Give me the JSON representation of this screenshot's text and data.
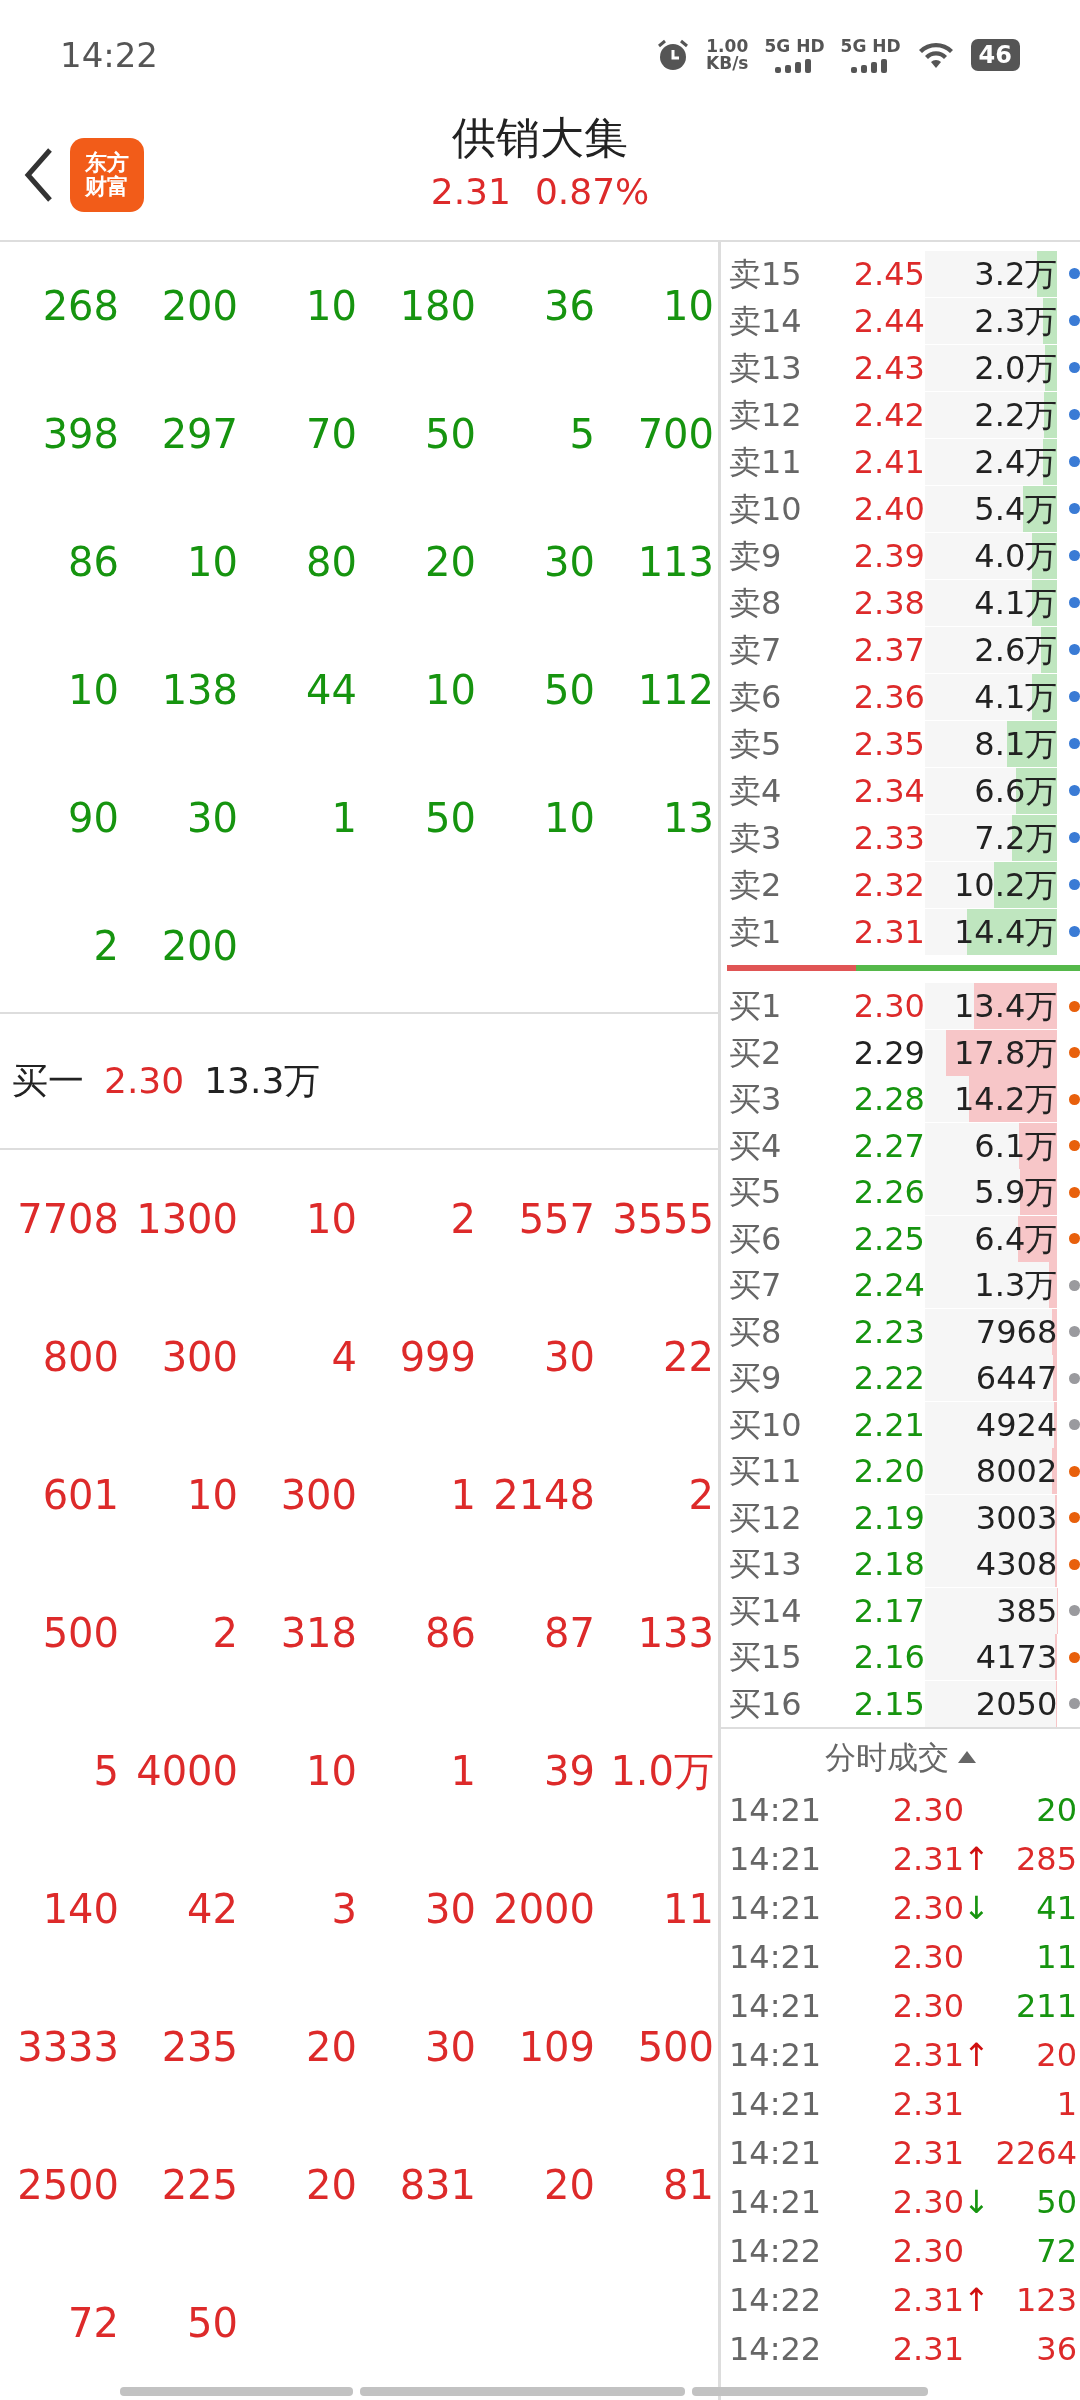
{
  "status_bar": {
    "time": "14:22",
    "net_speed": "1.00",
    "net_unit": "KB/s",
    "signals": [
      {
        "label": "5G HD"
      },
      {
        "label": "5G HD"
      }
    ],
    "battery": "46"
  },
  "header": {
    "logo_lines": [
      "东方",
      "财富"
    ],
    "title": "供销大集",
    "price": "2.31",
    "change": "0.87%"
  },
  "sell_queue": {
    "rows": [
      [
        "268",
        "200",
        "10",
        "180",
        "36",
        "10"
      ],
      [
        "398",
        "297",
        "70",
        "50",
        "5",
        "700"
      ],
      [
        "86",
        "10",
        "80",
        "20",
        "30",
        "113"
      ],
      [
        "10",
        "138",
        "44",
        "10",
        "50",
        "112"
      ],
      [
        "90",
        "30",
        "1",
        "50",
        "10",
        "13"
      ],
      [
        "2",
        "200"
      ]
    ]
  },
  "buy_one": {
    "label": "买一",
    "price": "2.30",
    "volume": "13.3万"
  },
  "buy_queue": {
    "rows": [
      [
        "7708",
        "1300",
        "10",
        "2",
        "557",
        "3555"
      ],
      [
        "800",
        "300",
        "4",
        "999",
        "30",
        "22"
      ],
      [
        "601",
        "10",
        "300",
        "1",
        "2148",
        "2"
      ],
      [
        "500",
        "2",
        "318",
        "86",
        "87",
        "133"
      ],
      [
        "5",
        "4000",
        "10",
        "1",
        "39",
        "1.0万"
      ],
      [
        "140",
        "42",
        "3",
        "30",
        "2000",
        "11"
      ],
      [
        "3333",
        "235",
        "20",
        "30",
        "109",
        "500"
      ],
      [
        "2500",
        "225",
        "20",
        "831",
        "20",
        "81"
      ],
      [
        "72",
        "50"
      ]
    ]
  },
  "order_book": {
    "asks": [
      {
        "label": "卖15",
        "price": {
          "text": "2.45",
          "color": "#dd2a2a"
        },
        "volume": "3.2万",
        "level": 0.15,
        "color": "#3a7bd5"
      },
      {
        "label": "卖14",
        "price": {
          "text": "2.44",
          "color": "#dd2a2a"
        },
        "volume": "2.3万",
        "level": 0.11,
        "color": "#3a7bd5"
      },
      {
        "label": "卖13",
        "price": {
          "text": "2.43",
          "color": "#dd2a2a"
        },
        "volume": "2.0万",
        "level": 0.09,
        "color": "#3a7bd5"
      },
      {
        "label": "卖12",
        "price": {
          "text": "2.42",
          "color": "#dd2a2a"
        },
        "volume": "2.2万",
        "level": 0.1,
        "color": "#3a7bd5"
      },
      {
        "label": "卖11",
        "price": {
          "text": "2.41",
          "color": "#dd2a2a"
        },
        "volume": "2.4万",
        "level": 0.11,
        "color": "#3a7bd5"
      },
      {
        "label": "卖10",
        "price": {
          "text": "2.40",
          "color": "#dd2a2a"
        },
        "volume": "5.4万",
        "level": 0.26,
        "color": "#3a7bd5"
      },
      {
        "label": "卖9",
        "price": {
          "text": "2.39",
          "color": "#dd2a2a"
        },
        "volume": "4.0万",
        "level": 0.19,
        "color": "#3a7bd5"
      },
      {
        "label": "卖8",
        "price": {
          "text": "2.38",
          "color": "#dd2a2a"
        },
        "volume": "4.1万",
        "level": 0.19,
        "color": "#3a7bd5"
      },
      {
        "label": "卖7",
        "price": {
          "text": "2.37",
          "color": "#dd2a2a"
        },
        "volume": "2.6万",
        "level": 0.12,
        "color": "#3a7bd5"
      },
      {
        "label": "卖6",
        "price": {
          "text": "2.36",
          "color": "#dd2a2a"
        },
        "volume": "4.1万",
        "level": 0.19,
        "color": "#3a7bd5"
      },
      {
        "label": "卖5",
        "price": {
          "text": "2.35",
          "color": "#dd2a2a"
        },
        "volume": "8.1万",
        "level": 0.38,
        "color": "#3a7bd5"
      },
      {
        "label": "卖4",
        "price": {
          "text": "2.34",
          "color": "#dd2a2a"
        },
        "volume": "6.6万",
        "level": 0.31,
        "color": "#3a7bd5"
      },
      {
        "label": "卖3",
        "price": {
          "text": "2.33",
          "color": "#dd2a2a"
        },
        "volume": "7.2万",
        "level": 0.34,
        "color": "#3a7bd5"
      },
      {
        "label": "卖2",
        "price": {
          "text": "2.32",
          "color": "#dd2a2a"
        },
        "volume": "10.2万",
        "level": 0.48,
        "color": "#3a7bd5"
      },
      {
        "label": "卖1",
        "price": {
          "text": "2.31",
          "color": "#dd2a2a"
        },
        "volume": "14.4万",
        "level": 0.68,
        "color": "#3a7bd5"
      }
    ],
    "ratio_bar": {
      "level": 0.36
    },
    "bids": [
      {
        "label": "买1",
        "price": {
          "text": "2.30",
          "color": "#dd2a2a"
        },
        "volume": "13.4万",
        "level": 0.63,
        "color": "#e8600c"
      },
      {
        "label": "买2",
        "price": {
          "text": "2.29",
          "color": "#222222"
        },
        "volume": "17.8万",
        "level": 0.84,
        "color": "#e8600c"
      },
      {
        "label": "买3",
        "price": {
          "text": "2.28",
          "color": "#16940f"
        },
        "volume": "14.2万",
        "level": 0.67,
        "color": "#e8600c"
      },
      {
        "label": "买4",
        "price": {
          "text": "2.27",
          "color": "#16940f"
        },
        "volume": "6.1万",
        "level": 0.29,
        "color": "#e8600c"
      },
      {
        "label": "买5",
        "price": {
          "text": "2.26",
          "color": "#16940f"
        },
        "volume": "5.9万",
        "level": 0.28,
        "color": "#e8600c"
      },
      {
        "label": "买6",
        "price": {
          "text": "2.25",
          "color": "#16940f"
        },
        "volume": "6.4万",
        "level": 0.3,
        "color": "#e8600c"
      },
      {
        "label": "买7",
        "price": {
          "text": "2.24",
          "color": "#16940f"
        },
        "volume": "1.3万",
        "level": 0.06,
        "color": "#9a9a9e"
      },
      {
        "label": "买8",
        "price": {
          "text": "2.23",
          "color": "#16940f"
        },
        "volume": "7968",
        "level": 0.04,
        "color": "#9a9a9e"
      },
      {
        "label": "买9",
        "price": {
          "text": "2.22",
          "color": "#16940f"
        },
        "volume": "6447",
        "level": 0.03,
        "color": "#9a9a9e"
      },
      {
        "label": "买10",
        "price": {
          "text": "2.21",
          "color": "#16940f"
        },
        "volume": "4924",
        "level": 0.023,
        "color": "#9a9a9e"
      },
      {
        "label": "买11",
        "price": {
          "text": "2.20",
          "color": "#16940f"
        },
        "volume": "8002",
        "level": 0.038,
        "color": "#e8600c"
      },
      {
        "label": "买12",
        "price": {
          "text": "2.19",
          "color": "#16940f"
        },
        "volume": "3003",
        "level": 0.014,
        "color": "#e8600c"
      },
      {
        "label": "买13",
        "price": {
          "text": "2.18",
          "color": "#16940f"
        },
        "volume": "4308",
        "level": 0.02,
        "color": "#e8600c"
      },
      {
        "label": "买14",
        "price": {
          "text": "2.17",
          "color": "#16940f"
        },
        "volume": "385",
        "level": 0.002,
        "color": "#9a9a9e"
      },
      {
        "label": "买15",
        "price": {
          "text": "2.16",
          "color": "#16940f"
        },
        "volume": "4173",
        "level": 0.02,
        "color": "#e8600c"
      },
      {
        "label": "买16",
        "price": {
          "text": "2.15",
          "color": "#16940f"
        },
        "volume": "2050",
        "level": 0.01,
        "color": "#9a9a9e"
      }
    ]
  },
  "ticks": {
    "title": "分时成交",
    "rows": [
      {
        "time": "14:21",
        "price": "2.30",
        "volume": {
          "text": "20",
          "color": "#16940f"
        }
      },
      {
        "time": "14:21",
        "price": "2.31",
        "arrow": {
          "text": "↑",
          "color": "#d01010"
        },
        "volume": {
          "text": "285",
          "color": "#dd2a2a"
        }
      },
      {
        "time": "14:21",
        "price": "2.30",
        "arrow": {
          "text": "↓",
          "color": "#16940f"
        },
        "volume": {
          "text": "41",
          "color": "#16940f"
        }
      },
      {
        "time": "14:21",
        "price": "2.30",
        "volume": {
          "text": "11",
          "color": "#16940f"
        }
      },
      {
        "time": "14:21",
        "price": "2.30",
        "volume": {
          "text": "211",
          "color": "#16940f"
        }
      },
      {
        "time": "14:21",
        "price": "2.31",
        "arrow": {
          "text": "↑",
          "color": "#d01010"
        },
        "volume": {
          "text": "20",
          "color": "#dd2a2a"
        }
      },
      {
        "time": "14:21",
        "price": "2.31",
        "volume": {
          "text": "1",
          "color": "#dd2a2a"
        }
      },
      {
        "time": "14:21",
        "price": "2.31",
        "volume": {
          "text": "2264",
          "color": "#dd2a2a"
        }
      },
      {
        "time": "14:21",
        "price": "2.30",
        "arrow": {
          "text": "↓",
          "color": "#16940f"
        },
        "volume": {
          "text": "50",
          "color": "#16940f"
        }
      },
      {
        "time": "14:22",
        "price": "2.30",
        "volume": {
          "text": "72",
          "color": "#16940f"
        }
      },
      {
        "time": "14:22",
        "price": "2.31",
        "arrow": {
          "text": "↑",
          "color": "#d01010"
        },
        "volume": {
          "text": "123",
          "color": "#dd2a2a"
        }
      },
      {
        "time": "14:22",
        "price": "2.31",
        "volume": {
          "text": "36",
          "color": "#dd2a2a"
        }
      }
    ]
  }
}
